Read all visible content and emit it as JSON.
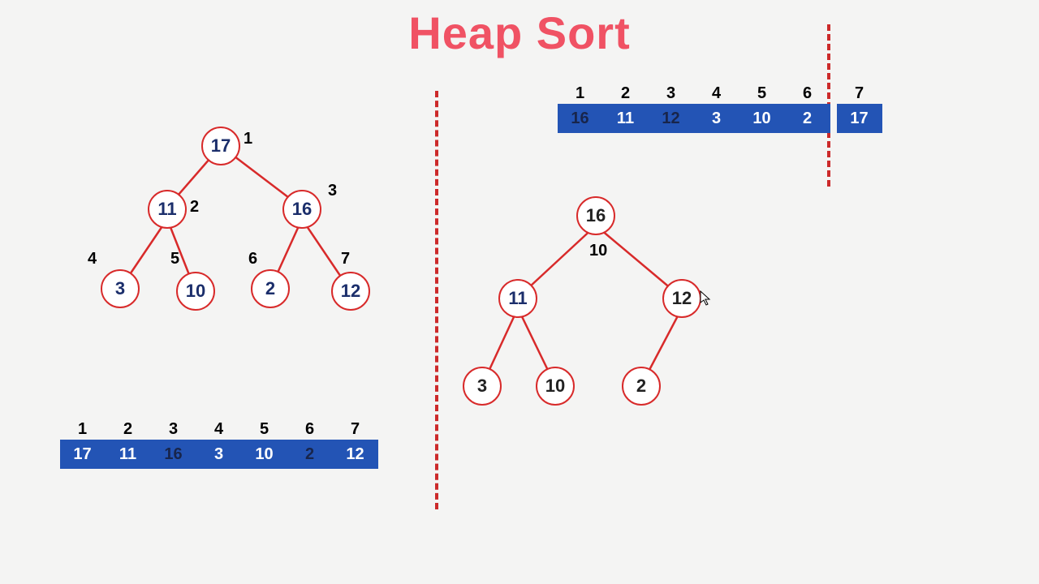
{
  "title": "Heap Sort",
  "arrays": {
    "left": {
      "indices": [
        "1",
        "2",
        "3",
        "4",
        "5",
        "6",
        "7"
      ],
      "values": [
        "17",
        "11",
        "16",
        "3",
        "10",
        "2",
        "12"
      ],
      "darkValues": [
        false,
        false,
        true,
        false,
        false,
        true,
        false
      ]
    },
    "right": {
      "indices": [
        "1",
        "2",
        "3",
        "4",
        "5",
        "6",
        "7"
      ],
      "values": [
        "16",
        "11",
        "12",
        "3",
        "10",
        "2",
        "17"
      ],
      "darkValues": [
        true,
        false,
        true,
        false,
        false,
        false,
        false
      ]
    }
  },
  "trees": {
    "left": {
      "nodes": {
        "n1": "17",
        "n2": "11",
        "n3": "16",
        "n4": "3",
        "n5": "10",
        "n6": "2",
        "n7": "12"
      },
      "labels": {
        "n1": "1",
        "n2": "2",
        "n3": "3",
        "n4": "4",
        "n5": "5",
        "n6": "6",
        "n7": "7"
      }
    },
    "right": {
      "nodes": {
        "n1": "16",
        "n2": "11",
        "n3": "12",
        "n4": "3",
        "n5": "10",
        "n6": "2"
      },
      "rootAnnotation": "10"
    }
  },
  "colors": {
    "accent": "#f05264",
    "nodeBorder": "#d82a2a",
    "arrayFill": "#2354b5"
  }
}
